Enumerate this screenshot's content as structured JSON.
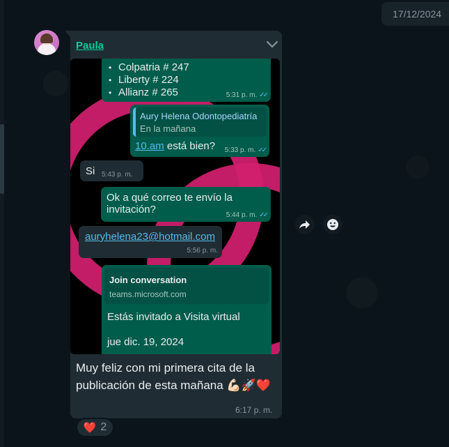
{
  "date_chip": "17/12/2024",
  "sender": {
    "name": "Paula"
  },
  "screenshot": {
    "banks": [
      "Colpatria # 247",
      "Liberty # 224",
      "Allianz # 265"
    ],
    "banks_time": "5:31 p. m.",
    "quote_author": "Aury Helena Odontopediatría",
    "quote_text": "En la mañana",
    "reply_link": "10.am",
    "reply_rest": " está bien?",
    "reply_time": "5:33 p. m.",
    "si_text": "Si",
    "si_time": "5:43 p. m.",
    "correo_text": "Ok a qué correo te envío la invitación?",
    "correo_time": "5:44 p. m.",
    "email": "auryhelena23@hotmail.com",
    "email_time": "5:56 p. m.",
    "teams_title": "Join conversation",
    "teams_domain": "teams.microsoft.com",
    "invite_text": "Estás invitado a Visita virtual",
    "invite_date": "jue dic. 19, 2024"
  },
  "caption": "Muy feliz con mi primera cita de la publicación de esta mañana 💪🏻🚀❤️",
  "caption_time": "6:17 p. m.",
  "reaction": {
    "emoji": "❤️",
    "count": "2"
  },
  "colors": {
    "accent": "#06cf9c",
    "outgoing": "#005c4b",
    "incoming": "#202c33",
    "link": "#53bdeb"
  },
  "icons": [
    "chevron-down-icon",
    "forward-icon",
    "emoji-icon",
    "double-check-icon"
  ]
}
